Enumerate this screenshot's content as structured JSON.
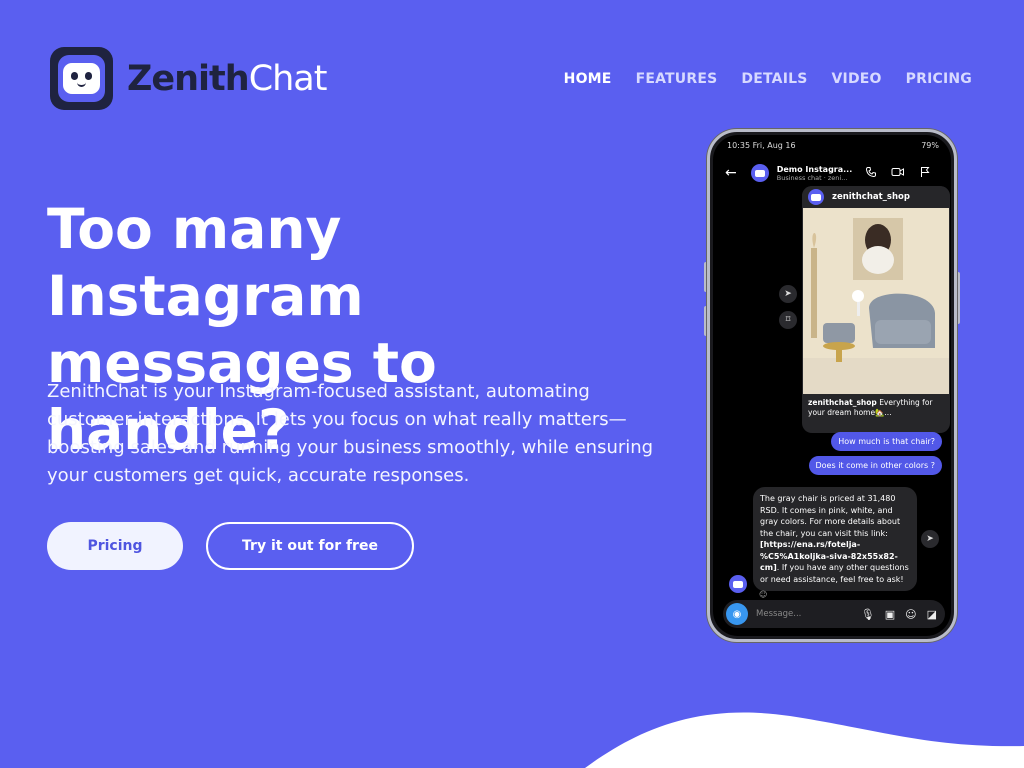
{
  "brand": {
    "name_part1": "Zenith",
    "name_part2": "Chat"
  },
  "nav": {
    "items": [
      {
        "label": "HOME",
        "active": true
      },
      {
        "label": "FEATURES",
        "active": false
      },
      {
        "label": "DETAILS",
        "active": false
      },
      {
        "label": "VIDEO",
        "active": false
      },
      {
        "label": "PRICING",
        "active": false
      }
    ]
  },
  "hero": {
    "title": "Too many Instagram messages to handle?",
    "description": "ZenithChat is your Instagram-focused assistant, automating customer interactions. It lets you focus on what really matters—boosting sales and running your business smoothly, while ensuring your customers get quick, accurate responses.",
    "btn_pricing": "Pricing",
    "btn_try": "Try it out for free"
  },
  "phone": {
    "status_time": "10:35  Fri, Aug 16",
    "status_right": "79%",
    "chat_name": "Demo Instagra...",
    "chat_sub": "Business chat · zeni...",
    "post_user": "zenithchat_shop",
    "post_caption_user": "zenithchat_shop",
    "post_caption_text": "Everything for your dream home🏡...",
    "msg_out_1": "How much is that chair?",
    "msg_out_2": "Does it come in other colors ?",
    "reply_part1": "The gray chair is priced at 31,480 RSD. It comes in pink, white, and gray colors. For more details about the chair, you can visit this link: ",
    "reply_link": "[https://ena.rs/fotelja-%C5%A1koljka-siva-82x55x82-cm]",
    "reply_part2": ". If you have any other questions or need assistance, feel free to ask!",
    "input_placeholder": "Message..."
  },
  "colors": {
    "background": "#5a5ff0",
    "logo_dark": "#1f2340",
    "bubble_out": "#5258e8"
  }
}
